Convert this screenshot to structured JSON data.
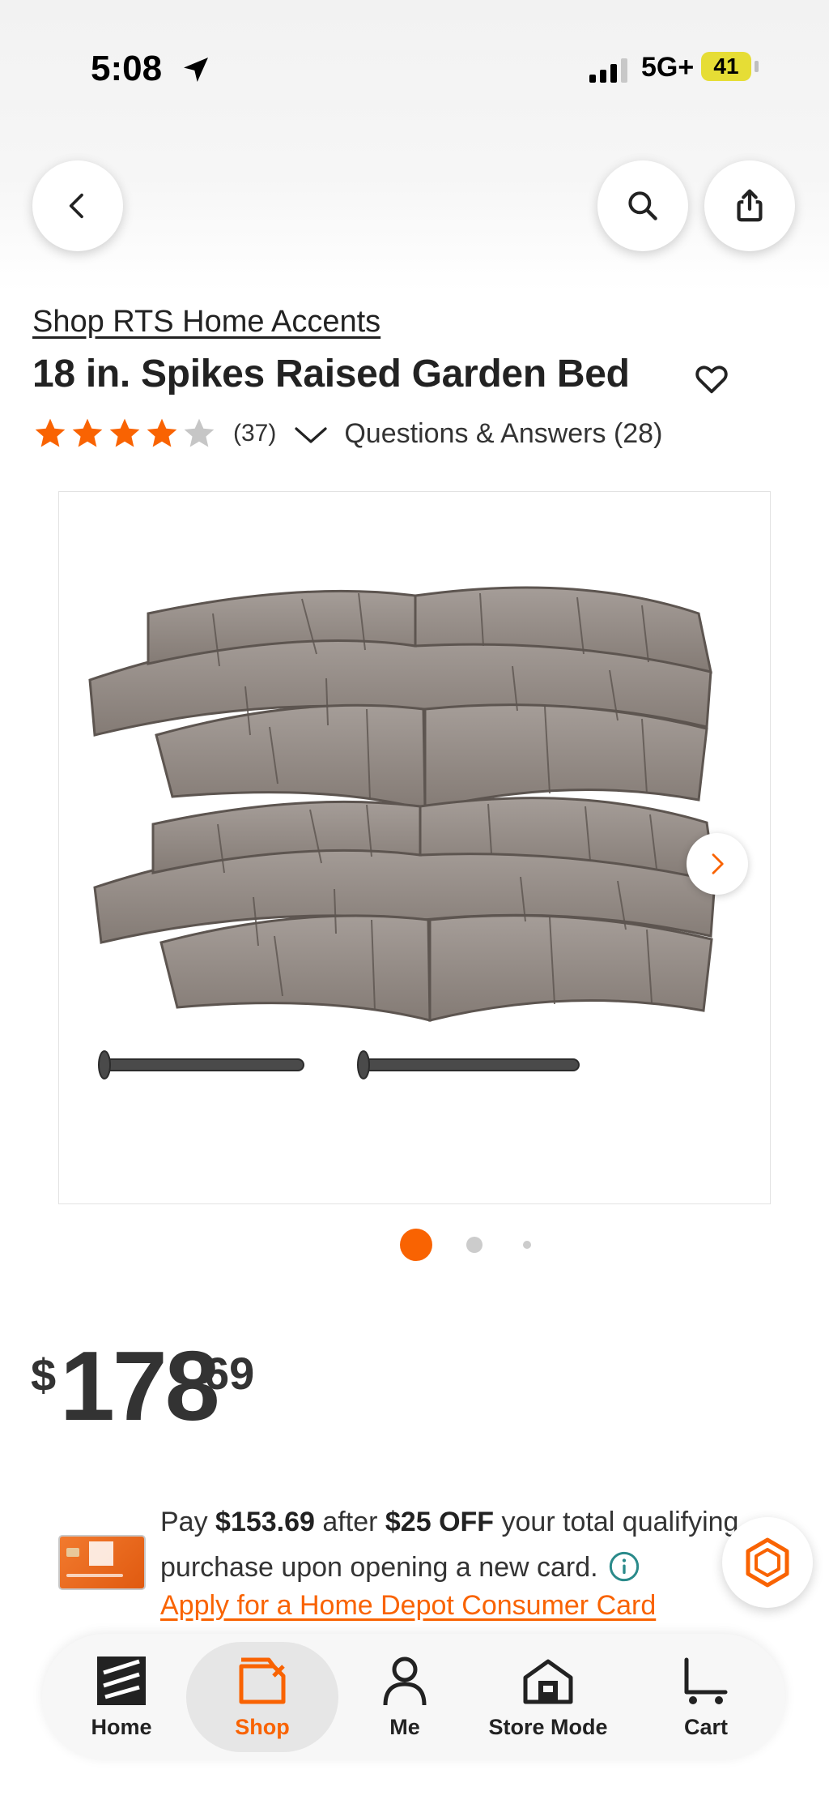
{
  "status_bar": {
    "time": "5:08",
    "network": "5G+",
    "battery": "41"
  },
  "nav": {
    "back": "back",
    "search": "search",
    "share": "share"
  },
  "product": {
    "brand_link": "Shop RTS Home Accents",
    "title": "18 in. Spikes Raised Garden Bed",
    "rating": 4,
    "rating_max": 5,
    "review_count": "(37)",
    "qa_label": "Questions & Answers (28)"
  },
  "gallery": {
    "current_index": 1,
    "total_images": 3
  },
  "price": {
    "currency": "$",
    "dollars": "178",
    "cents": "69"
  },
  "promo": {
    "text_1": "Pay ",
    "amount": "$153.69",
    "text_2": " after ",
    "discount": "$25 OFF",
    "text_3": " your total qualifying purchase upon opening a new card.",
    "apply_link": "Apply for a Home Depot Consumer Card"
  },
  "tabbar": {
    "items": [
      {
        "label": "Home",
        "icon": "home-depot-logo-icon"
      },
      {
        "label": "Shop",
        "icon": "shop-bag-icon",
        "active": true
      },
      {
        "label": "Me",
        "icon": "person-icon"
      },
      {
        "label": "Store Mode",
        "icon": "store-icon"
      },
      {
        "label": "Cart",
        "icon": "cart-icon"
      }
    ]
  },
  "colors": {
    "accent": "#f96302",
    "text": "#222222",
    "star": "#f96302",
    "star_empty": "#c6c6c6"
  }
}
